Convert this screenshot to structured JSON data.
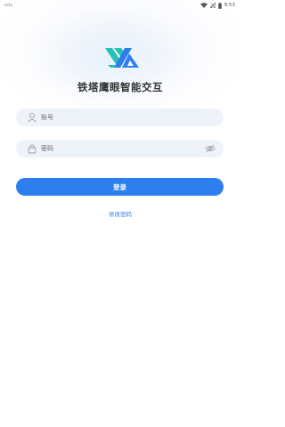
{
  "status_bar": {
    "left_text": "sds",
    "time": "9:53",
    "wifi_icon": "wifi-icon",
    "signal_icon": "signal-icon",
    "battery_icon": "battery-icon"
  },
  "app": {
    "title": "铁塔鹰眼智能交互",
    "logo_icon": "logo-icon",
    "brand_colors": [
      "#27c2b5",
      "#2d7ff0"
    ]
  },
  "form": {
    "account": {
      "placeholder": "账号",
      "value": "",
      "icon": "user-icon"
    },
    "password": {
      "placeholder": "密码",
      "value": "",
      "icon": "lock-icon",
      "toggle_icon": "eye-closed-icon"
    }
  },
  "login_button": {
    "label": "登录",
    "color": "#2d7ff0"
  },
  "change_password_link": {
    "label": "修改密码"
  }
}
